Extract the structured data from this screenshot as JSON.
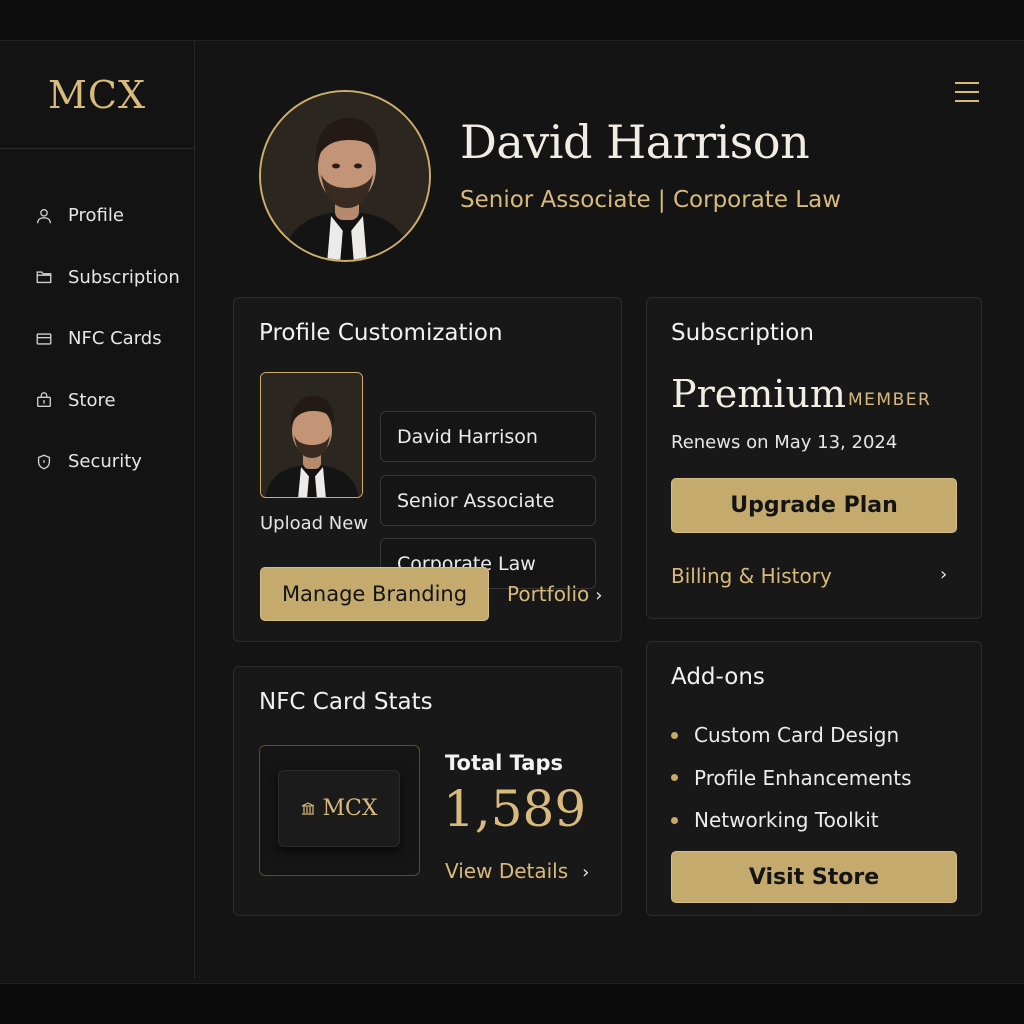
{
  "app": {
    "logo": "MCX"
  },
  "sidebar": {
    "items": [
      {
        "label": "Profile",
        "icon": "user-icon"
      },
      {
        "label": "Subscription",
        "icon": "folder-icon"
      },
      {
        "label": "NFC Cards",
        "icon": "card-icon"
      },
      {
        "label": "Store",
        "icon": "store-icon"
      },
      {
        "label": "Security",
        "icon": "shield-icon"
      }
    ]
  },
  "header": {
    "name": "David Harrison",
    "role": "Senior Associate | Corporate Law",
    "menu_icon": "hamburger-icon"
  },
  "profile_customization": {
    "title": "Profile Customization",
    "upload_label": "Upload New",
    "fields": [
      "David Harrison",
      "Senior Associate",
      "Corporate Law"
    ],
    "manage_label": "Manage Branding",
    "portfolio_label": "Portfolio"
  },
  "subscription": {
    "title": "Subscription",
    "plan": "Premium",
    "member_label": "MEMBER",
    "renews": "Renews on May 13, 2024",
    "upgrade_label": "Upgrade Plan",
    "billing_label": "Billing & History"
  },
  "nfc_stats": {
    "title": "NFC Card Stats",
    "card_logo": "MCX",
    "taps_label": "Total Taps",
    "taps_value": "1,589",
    "details_label": "View Details"
  },
  "addons": {
    "title": "Add-ons",
    "items": [
      "Custom Card Design",
      "Profile Enhancements",
      "Networking Toolkit"
    ],
    "store_label": "Visit Store"
  },
  "colors": {
    "accent": "#d8bb7c",
    "button": "#c5aa6e",
    "background": "#141414",
    "card": "#181818"
  }
}
